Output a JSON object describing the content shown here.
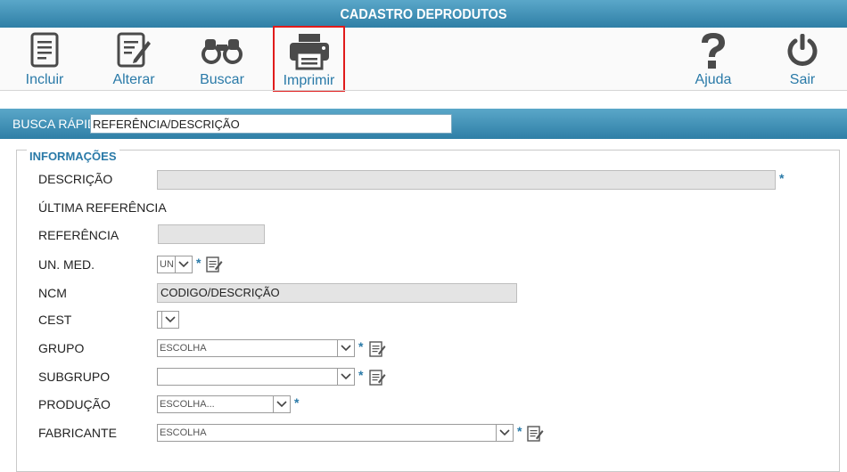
{
  "window": {
    "title": "CADASTRO DEPRODUTOS"
  },
  "toolbar": {
    "incluir": "Incluir",
    "alterar": "Alterar",
    "buscar": "Buscar",
    "imprimir": "Imprimir",
    "ajuda": "Ajuda",
    "sair": "Sair"
  },
  "search": {
    "label": "BUSCA RÁPIDA",
    "value": "REFERÊNCIA/DESCRIÇÃO"
  },
  "form": {
    "legend": "INFORMAÇÕES",
    "labels": {
      "descricao": "DESCRIÇÃO",
      "ultima_referencia": "ÚLTIMA REFERÊNCIA",
      "referencia": "REFERÊNCIA",
      "un_med": "UN. MED.",
      "ncm": "NCM",
      "cest": "CEST",
      "grupo": "GRUPO",
      "subgrupo": "SUBGRUPO",
      "producao": "PRODUÇÃO",
      "fabricante": "FABRICANTE"
    },
    "values": {
      "descricao": "",
      "referencia": "",
      "un_med": "UN",
      "ncm": "CODIGO/DESCRIÇÃO",
      "cest": "",
      "grupo": "ESCOLHA",
      "subgrupo": "",
      "producao": "ESCOLHA...",
      "fabricante": "ESCOLHA"
    },
    "required_mark": "*"
  },
  "colors": {
    "accent": "#2a7aa8",
    "header": "#3d8db4",
    "highlight": "#e01b1b"
  }
}
